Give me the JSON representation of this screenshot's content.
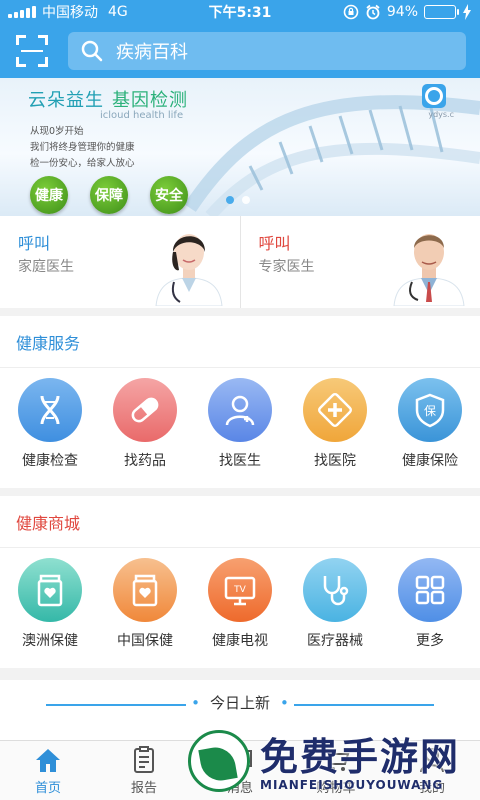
{
  "status": {
    "carrier": "中国移动",
    "network": "4G",
    "time": "下午5:31",
    "battery_text": "94%",
    "battery_level": 0.94
  },
  "header": {
    "search_placeholder": "疾病百科"
  },
  "banner": {
    "title_a": "云朵益生",
    "title_b": "基因检测",
    "subtitle": "icloud health life",
    "lines": [
      "从现0岁开始",
      "我们将终身管理你的健康",
      "检一份安心，给家人放心"
    ],
    "pills": [
      "健康",
      "保障",
      "安全"
    ],
    "logo_text": "ydys.c"
  },
  "doctors": [
    {
      "call": "呼叫",
      "desc": "家庭医生"
    },
    {
      "call": "呼叫",
      "desc": "专家医生"
    }
  ],
  "health_service": {
    "title": "健康服务",
    "items": [
      {
        "label": "健康检查",
        "icon": "dna-icon",
        "color": "#3f8fe0"
      },
      {
        "label": "找药品",
        "icon": "pill-icon",
        "color": "#e96a6a"
      },
      {
        "label": "找医生",
        "icon": "doctor-icon",
        "color": "#5a86e6"
      },
      {
        "label": "找医院",
        "icon": "hospital-icon",
        "color": "#f0a63a"
      },
      {
        "label": "健康保险",
        "icon": "insurance-shield-icon",
        "color": "#3a94d8"
      }
    ]
  },
  "health_mall": {
    "title": "健康商城",
    "items": [
      {
        "label": "澳洲保健",
        "icon": "jar-icon",
        "color": "#35b8a8"
      },
      {
        "label": "中国保健",
        "icon": "jar-icon",
        "color": "#f0883a"
      },
      {
        "label": "健康电视",
        "icon": "tv-icon",
        "color": "#ee6a2c"
      },
      {
        "label": "医疗器械",
        "icon": "stethoscope-icon",
        "color": "#4ab3e2"
      },
      {
        "label": "更多",
        "icon": "grid-icon",
        "color": "#4f8fe6"
      }
    ]
  },
  "today": {
    "title": "今日上新"
  },
  "tabs": [
    {
      "label": "首页",
      "icon": "home-icon"
    },
    {
      "label": "报告",
      "icon": "report-icon"
    },
    {
      "label": "消息",
      "icon": "message-icon"
    },
    {
      "label": "购物车",
      "icon": "cart-icon"
    },
    {
      "label": "我的",
      "icon": "profile-icon"
    }
  ],
  "watermark": {
    "title": "免费手游网",
    "url": "MIANFEISHOUYOUWANG"
  },
  "colors": {
    "primary": "#3aa4ea",
    "accent_red": "#e0483f",
    "tab_active": "#2f8fd8"
  }
}
